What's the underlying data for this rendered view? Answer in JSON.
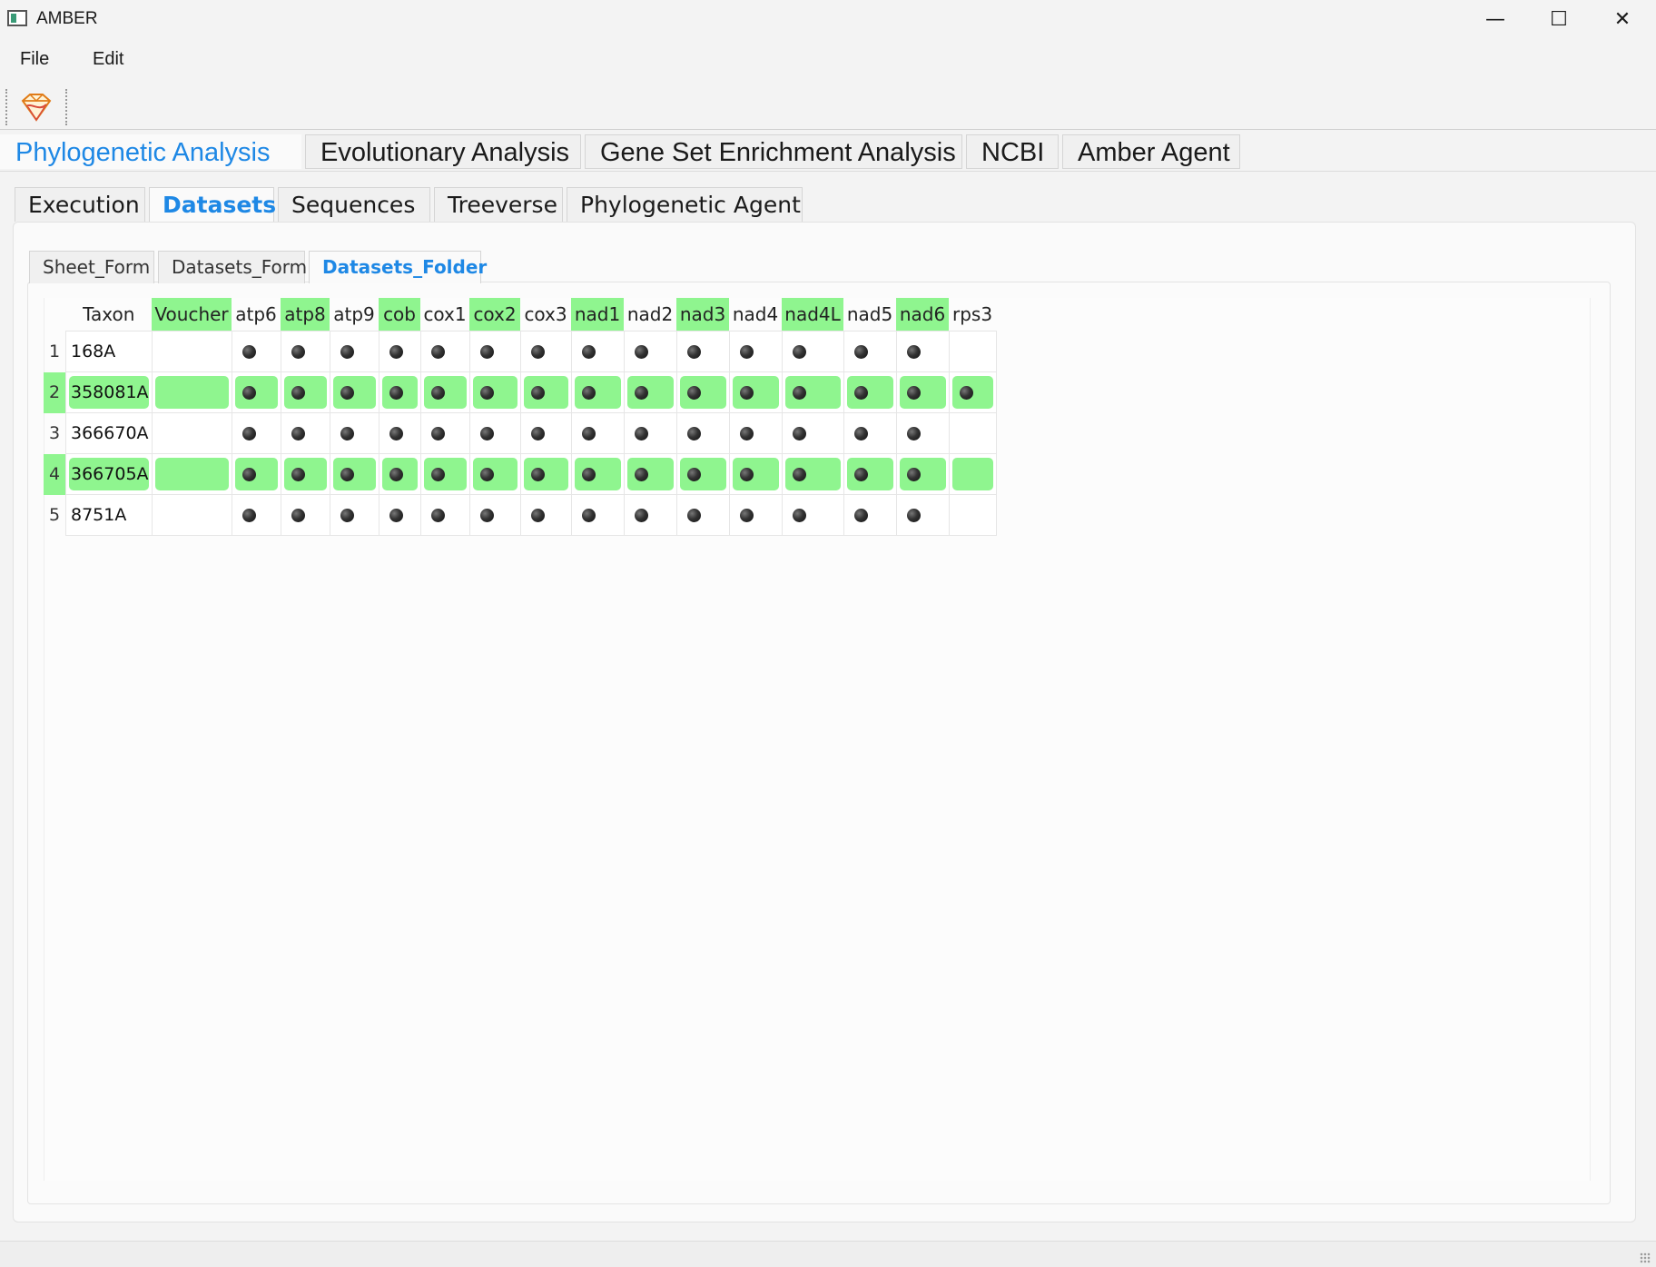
{
  "window": {
    "title": "AMBER",
    "minimize": "—",
    "maximize": "☐",
    "close": "✕"
  },
  "menu": {
    "items": [
      "File",
      "Edit"
    ]
  },
  "toolbar": {
    "logo_icon": "amber-gem-icon"
  },
  "main_tabs": [
    "Phylogenetic Analysis",
    "Evolutionary Analysis",
    "Gene Set Enrichment Analysis",
    "NCBI",
    "Amber Agent"
  ],
  "sub_tabs": [
    "Execution",
    "Datasets",
    "Sequences",
    "Treeverse",
    "Phylogenetic Agent"
  ],
  "inner_tabs": [
    "Sheet_Form",
    "Datasets_Form",
    "Datasets_Folder"
  ],
  "table": {
    "columns": [
      "Taxon",
      "Voucher",
      "atp6",
      "atp8",
      "atp9",
      "cob",
      "cox1",
      "cox2",
      "cox3",
      "nad1",
      "nad2",
      "nad3",
      "nad4",
      "nad4L",
      "nad5",
      "nad6",
      "rps3"
    ],
    "highlighted_columns": [
      "Voucher",
      "atp8",
      "cob",
      "cox2",
      "nad1",
      "nad3",
      "nad4L",
      "nad6"
    ],
    "rows": [
      {
        "num": "1",
        "taxon": "168A",
        "highlight": false,
        "present": [
          false,
          true,
          true,
          true,
          true,
          true,
          true,
          true,
          true,
          true,
          true,
          true,
          true,
          true,
          true,
          false
        ]
      },
      {
        "num": "2",
        "taxon": "358081A",
        "highlight": true,
        "present": [
          false,
          true,
          true,
          true,
          true,
          true,
          true,
          true,
          true,
          true,
          true,
          true,
          true,
          true,
          true,
          true
        ]
      },
      {
        "num": "3",
        "taxon": "366670A",
        "highlight": false,
        "present": [
          false,
          true,
          true,
          true,
          true,
          true,
          true,
          true,
          true,
          true,
          true,
          true,
          true,
          true,
          true,
          false
        ]
      },
      {
        "num": "4",
        "taxon": "366705A",
        "highlight": true,
        "present": [
          false,
          true,
          true,
          true,
          true,
          true,
          true,
          true,
          true,
          true,
          true,
          true,
          true,
          true,
          true,
          false
        ]
      },
      {
        "num": "5",
        "taxon": "8751A",
        "highlight": false,
        "present": [
          false,
          true,
          true,
          true,
          true,
          true,
          true,
          true,
          true,
          true,
          true,
          true,
          true,
          true,
          true,
          false
        ]
      }
    ]
  },
  "colors": {
    "accent": "#1e88e5",
    "highlight": "#8ff58f"
  }
}
